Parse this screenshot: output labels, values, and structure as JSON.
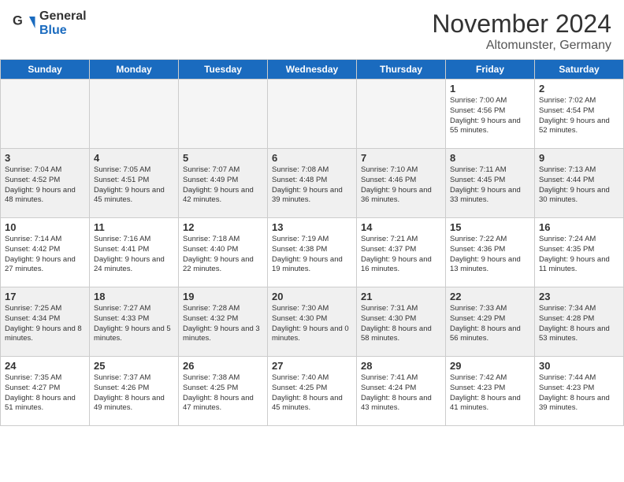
{
  "header": {
    "logo": {
      "general": "General",
      "blue": "Blue"
    },
    "title": "November 2024",
    "location": "Altomunster, Germany"
  },
  "calendar": {
    "days_of_week": [
      "Sunday",
      "Monday",
      "Tuesday",
      "Wednesday",
      "Thursday",
      "Friday",
      "Saturday"
    ],
    "weeks": [
      [
        {
          "day": "",
          "empty": true
        },
        {
          "day": "",
          "empty": true
        },
        {
          "day": "",
          "empty": true
        },
        {
          "day": "",
          "empty": true
        },
        {
          "day": "",
          "empty": true
        },
        {
          "day": "1",
          "sunrise": "7:00 AM",
          "sunset": "4:56 PM",
          "daylight": "9 hours and 55 minutes."
        },
        {
          "day": "2",
          "sunrise": "7:02 AM",
          "sunset": "4:54 PM",
          "daylight": "9 hours and 52 minutes."
        }
      ],
      [
        {
          "day": "3",
          "sunrise": "7:04 AM",
          "sunset": "4:52 PM",
          "daylight": "9 hours and 48 minutes."
        },
        {
          "day": "4",
          "sunrise": "7:05 AM",
          "sunset": "4:51 PM",
          "daylight": "9 hours and 45 minutes."
        },
        {
          "day": "5",
          "sunrise": "7:07 AM",
          "sunset": "4:49 PM",
          "daylight": "9 hours and 42 minutes."
        },
        {
          "day": "6",
          "sunrise": "7:08 AM",
          "sunset": "4:48 PM",
          "daylight": "9 hours and 39 minutes."
        },
        {
          "day": "7",
          "sunrise": "7:10 AM",
          "sunset": "4:46 PM",
          "daylight": "9 hours and 36 minutes."
        },
        {
          "day": "8",
          "sunrise": "7:11 AM",
          "sunset": "4:45 PM",
          "daylight": "9 hours and 33 minutes."
        },
        {
          "day": "9",
          "sunrise": "7:13 AM",
          "sunset": "4:44 PM",
          "daylight": "9 hours and 30 minutes."
        }
      ],
      [
        {
          "day": "10",
          "sunrise": "7:14 AM",
          "sunset": "4:42 PM",
          "daylight": "9 hours and 27 minutes."
        },
        {
          "day": "11",
          "sunrise": "7:16 AM",
          "sunset": "4:41 PM",
          "daylight": "9 hours and 24 minutes."
        },
        {
          "day": "12",
          "sunrise": "7:18 AM",
          "sunset": "4:40 PM",
          "daylight": "9 hours and 22 minutes."
        },
        {
          "day": "13",
          "sunrise": "7:19 AM",
          "sunset": "4:38 PM",
          "daylight": "9 hours and 19 minutes."
        },
        {
          "day": "14",
          "sunrise": "7:21 AM",
          "sunset": "4:37 PM",
          "daylight": "9 hours and 16 minutes."
        },
        {
          "day": "15",
          "sunrise": "7:22 AM",
          "sunset": "4:36 PM",
          "daylight": "9 hours and 13 minutes."
        },
        {
          "day": "16",
          "sunrise": "7:24 AM",
          "sunset": "4:35 PM",
          "daylight": "9 hours and 11 minutes."
        }
      ],
      [
        {
          "day": "17",
          "sunrise": "7:25 AM",
          "sunset": "4:34 PM",
          "daylight": "9 hours and 8 minutes."
        },
        {
          "day": "18",
          "sunrise": "7:27 AM",
          "sunset": "4:33 PM",
          "daylight": "9 hours and 5 minutes."
        },
        {
          "day": "19",
          "sunrise": "7:28 AM",
          "sunset": "4:32 PM",
          "daylight": "9 hours and 3 minutes."
        },
        {
          "day": "20",
          "sunrise": "7:30 AM",
          "sunset": "4:30 PM",
          "daylight": "9 hours and 0 minutes."
        },
        {
          "day": "21",
          "sunrise": "7:31 AM",
          "sunset": "4:30 PM",
          "daylight": "8 hours and 58 minutes."
        },
        {
          "day": "22",
          "sunrise": "7:33 AM",
          "sunset": "4:29 PM",
          "daylight": "8 hours and 56 minutes."
        },
        {
          "day": "23",
          "sunrise": "7:34 AM",
          "sunset": "4:28 PM",
          "daylight": "8 hours and 53 minutes."
        }
      ],
      [
        {
          "day": "24",
          "sunrise": "7:35 AM",
          "sunset": "4:27 PM",
          "daylight": "8 hours and 51 minutes."
        },
        {
          "day": "25",
          "sunrise": "7:37 AM",
          "sunset": "4:26 PM",
          "daylight": "8 hours and 49 minutes."
        },
        {
          "day": "26",
          "sunrise": "7:38 AM",
          "sunset": "4:25 PM",
          "daylight": "8 hours and 47 minutes."
        },
        {
          "day": "27",
          "sunrise": "7:40 AM",
          "sunset": "4:25 PM",
          "daylight": "8 hours and 45 minutes."
        },
        {
          "day": "28",
          "sunrise": "7:41 AM",
          "sunset": "4:24 PM",
          "daylight": "8 hours and 43 minutes."
        },
        {
          "day": "29",
          "sunrise": "7:42 AM",
          "sunset": "4:23 PM",
          "daylight": "8 hours and 41 minutes."
        },
        {
          "day": "30",
          "sunrise": "7:44 AM",
          "sunset": "4:23 PM",
          "daylight": "8 hours and 39 minutes."
        }
      ]
    ]
  }
}
